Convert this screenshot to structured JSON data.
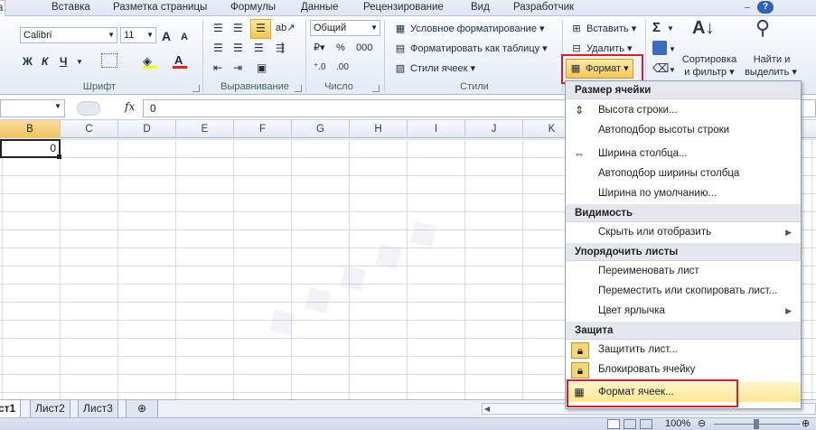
{
  "tabs": [
    "а",
    "Вставка",
    "Разметка страницы",
    "Формулы",
    "Данные",
    "Рецензирование",
    "Вид",
    "Разработчик"
  ],
  "window_icons": {
    "help": "?",
    "minimize": "–"
  },
  "font": {
    "name": "Calibri",
    "size": "11",
    "grow": "A",
    "shrink": "A",
    "bold": "Ж",
    "italic": "К",
    "underline": "Ч",
    "fill_color": "#ffff00",
    "font_color": "#e02020"
  },
  "number": {
    "format": "Общий"
  },
  "styles": {
    "conditional": "Условное форматирование",
    "as_table": "Форматировать как таблицу",
    "cell_styles": "Стили ячеек"
  },
  "cells": {
    "insert": "Вставить",
    "delete": "Удалить",
    "format": "Формат"
  },
  "editing": {
    "sort_line1": "Сортировка",
    "sort_line2": "и фильтр",
    "find_line1": "Найти и",
    "find_line2": "выделить"
  },
  "groups": {
    "font": "Шрифт",
    "alignment": "Выравнивание",
    "number": "Число",
    "styles": "Стили"
  },
  "formula_bar": {
    "fx": "fx",
    "value": "0"
  },
  "columns": [
    "B",
    "C",
    "D",
    "E",
    "F",
    "G",
    "H",
    "I",
    "J",
    "K"
  ],
  "active_cell_value": "0",
  "sheets": [
    "ст1",
    "Лист2",
    "Лист3"
  ],
  "status": {
    "zoom": "100%"
  },
  "menu": {
    "sections": [
      {
        "title": "Размер ячейки",
        "items": [
          {
            "label": "Высота строки...",
            "icon": "row-height-icon"
          },
          {
            "label": "Автоподбор высоты строки",
            "icon": ""
          },
          {
            "label": "Ширина столбца...",
            "icon": "column-width-icon"
          },
          {
            "label": "Автоподбор ширины столбца",
            "icon": ""
          },
          {
            "label": "Ширина по умолчанию...",
            "icon": ""
          }
        ]
      },
      {
        "title": "Видимость",
        "items": [
          {
            "label": "Скрыть или отобразить",
            "icon": "",
            "submenu": true
          }
        ]
      },
      {
        "title": "Упорядочить листы",
        "items": [
          {
            "label": "Переименовать лист",
            "icon": ""
          },
          {
            "label": "Переместить или скопировать лист...",
            "icon": ""
          },
          {
            "label": "Цвет ярлычка",
            "icon": "",
            "submenu": true
          }
        ]
      },
      {
        "title": "Защита",
        "items": [
          {
            "label": "Защитить лист...",
            "icon": "lock-icon"
          },
          {
            "label": "Блокировать ячейку",
            "icon": "lock-icon"
          },
          {
            "label": "Формат ячеек...",
            "icon": "format-cells-icon",
            "highlight": true
          }
        ]
      }
    ]
  },
  "colors": {
    "accent_red": "#d21f2f",
    "highlight": "#fde794"
  }
}
